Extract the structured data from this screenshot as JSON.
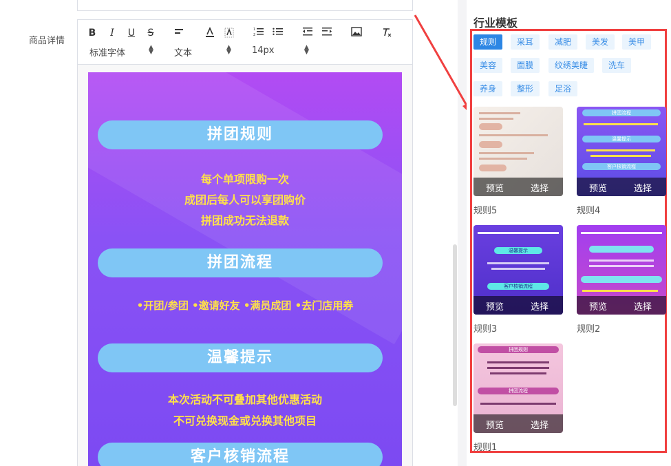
{
  "form": {
    "field_label": "商品详情"
  },
  "toolbar": {
    "bold": "B",
    "italic": "I",
    "underline": "U",
    "strike": "S",
    "font_family": "标准字体",
    "text_type": "文本",
    "font_size": "14px"
  },
  "poster": {
    "section1_title": "拼团规则",
    "rules": [
      "每个单项限购一次",
      "成团后每人可以享团购价",
      "拼团成功无法退款"
    ],
    "section2_title": "拼团流程",
    "flow": "•开团/参团 •邀请好友 •满员成团 •去门店用券",
    "section3_title": "温馨提示",
    "tips": [
      "本次活动不可叠加其他优惠活动",
      "不可兑换现金或兑换其他项目"
    ],
    "section4_title": "客户核销流程"
  },
  "sidebar": {
    "title": "行业模板",
    "tags": [
      "规则",
      "采耳",
      "减肥",
      "美发",
      "美甲",
      "美容",
      "面膜",
      "纹绣美睫",
      "洗车",
      "养身",
      "整形",
      "足浴"
    ],
    "active_tag": "规则",
    "templates": [
      {
        "name": "规则5",
        "preview": "预览",
        "select": "选择"
      },
      {
        "name": "规则4",
        "preview": "预览",
        "select": "选择"
      },
      {
        "name": "规则3",
        "preview": "预览",
        "select": "选择"
      },
      {
        "name": "规则2",
        "preview": "预览",
        "select": "选择"
      },
      {
        "name": "规则1",
        "preview": "预览",
        "select": "选择"
      }
    ],
    "thumb_labels": {
      "t4_title": "拼团流程",
      "t4_banner1": "温馨提示",
      "t4_banner2": "客户核销流程",
      "t3_banner1": "温馨提示",
      "t3_banner2": "客户核销流程",
      "t1_title1": "拼团规则",
      "t1_title2": "拼团流程"
    }
  },
  "colors": {
    "accent": "#2d86e4",
    "highlight": "#f04040",
    "poster_text": "#ffe14a"
  }
}
